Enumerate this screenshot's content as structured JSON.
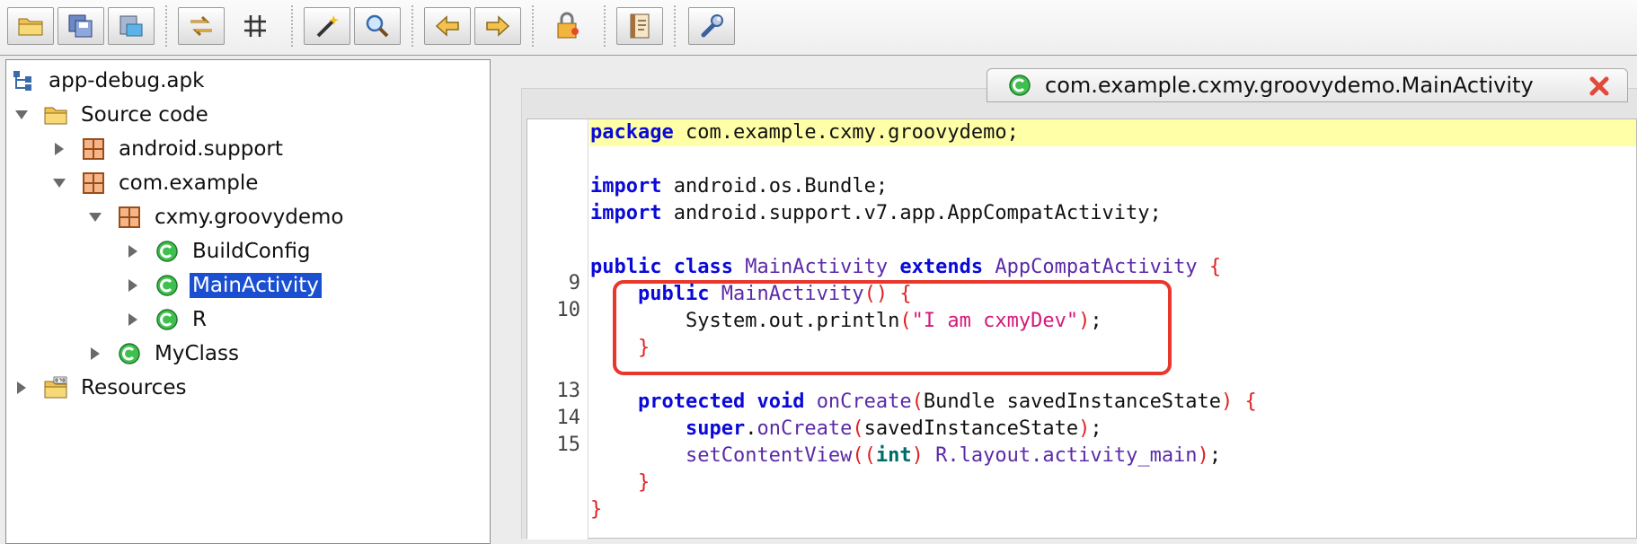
{
  "toolbar": {
    "buttons": [
      {
        "name": "open-file-button",
        "icon": "folder-open-icon"
      },
      {
        "name": "save-all-button",
        "icon": "save-all-icon"
      },
      {
        "name": "export-button",
        "icon": "export-disk-icon"
      },
      {
        "name": "sync-button",
        "icon": "sync-arrows-icon"
      },
      {
        "name": "flatten-packages-button",
        "icon": "grid-package-icon"
      },
      {
        "name": "decompile-button",
        "icon": "magic-wand-icon"
      },
      {
        "name": "search-button",
        "icon": "search-icon"
      },
      {
        "name": "back-button",
        "icon": "arrow-left-icon"
      },
      {
        "name": "forward-button",
        "icon": "arrow-right-icon"
      },
      {
        "name": "deobfuscation-button",
        "icon": "lock-icon"
      },
      {
        "name": "log-viewer-button",
        "icon": "log-document-icon"
      },
      {
        "name": "preferences-button",
        "icon": "wrench-icon"
      }
    ]
  },
  "tree": {
    "items": [
      {
        "label": "app-debug.apk",
        "icon": "apk-root-icon",
        "toggle": "none",
        "depth": 0
      },
      {
        "label": "Source code",
        "icon": "folder-icon",
        "toggle": "expanded",
        "depth": 0
      },
      {
        "label": "android.support",
        "icon": "package-icon",
        "toggle": "collapsed",
        "depth": 1
      },
      {
        "label": "com.example",
        "icon": "package-icon",
        "toggle": "expanded",
        "depth": 1
      },
      {
        "label": "cxmy.groovydemo",
        "icon": "package-icon",
        "toggle": "expanded",
        "depth": 2
      },
      {
        "label": "BuildConfig",
        "icon": "class-icon",
        "toggle": "collapsed",
        "depth": 3
      },
      {
        "label": "MainActivity",
        "icon": "class-icon",
        "toggle": "collapsed",
        "depth": 3,
        "selected": true
      },
      {
        "label": "R",
        "icon": "class-icon",
        "toggle": "collapsed",
        "depth": 3
      },
      {
        "label": "MyClass",
        "icon": "class-icon",
        "toggle": "collapsed",
        "depth": 2
      },
      {
        "label": "Resources",
        "icon": "resources-folder-icon",
        "toggle": "collapsed",
        "depth": 0
      }
    ]
  },
  "editor": {
    "tab_title": "com.example.cxmy.groovydemo.MainActivity",
    "line_numbers": [
      "9",
      "10",
      "13",
      "14",
      "15"
    ],
    "code": {
      "package_kw": "package",
      "package_name": " com.example.cxmy.groovydemo;",
      "import_kw": "import",
      "import_1": " android.os.Bundle;",
      "import_2": " android.support.v7.app.AppCompatActivity;",
      "public_kw": "public",
      "class_kw": "class",
      "class_name": "MainActivity",
      "extends_kw": "extends",
      "super_name": "AppCompatActivity",
      "open_brace": "{",
      "close_brace": "}",
      "ctor_name": "MainActivity",
      "ctor_parens": "()",
      "println_call": "System.out.println",
      "open_paren": "(",
      "close_paren": ")",
      "println_arg": "\"I am cxmyDev\"",
      "semicolon": ";",
      "protected_kw": "protected",
      "void_kw": "void",
      "oncreate_name": "onCreate",
      "oncreate_params": "Bundle savedInstanceState",
      "super_kw": "super",
      "dot": ".",
      "super_args": "savedInstanceState",
      "setcontentview": "setContentView",
      "int_kw": "int",
      "layout_ref": "R.layout.activity_main",
      "space": " "
    }
  },
  "colors": {
    "keyword": "#0a0ad8",
    "type": "#5b2aa8",
    "string": "#d4197a",
    "brace": "#e02020",
    "highlight_line": "#ffffa8",
    "annotation_box": "#e8372b",
    "selection": "#1b4fd1"
  }
}
